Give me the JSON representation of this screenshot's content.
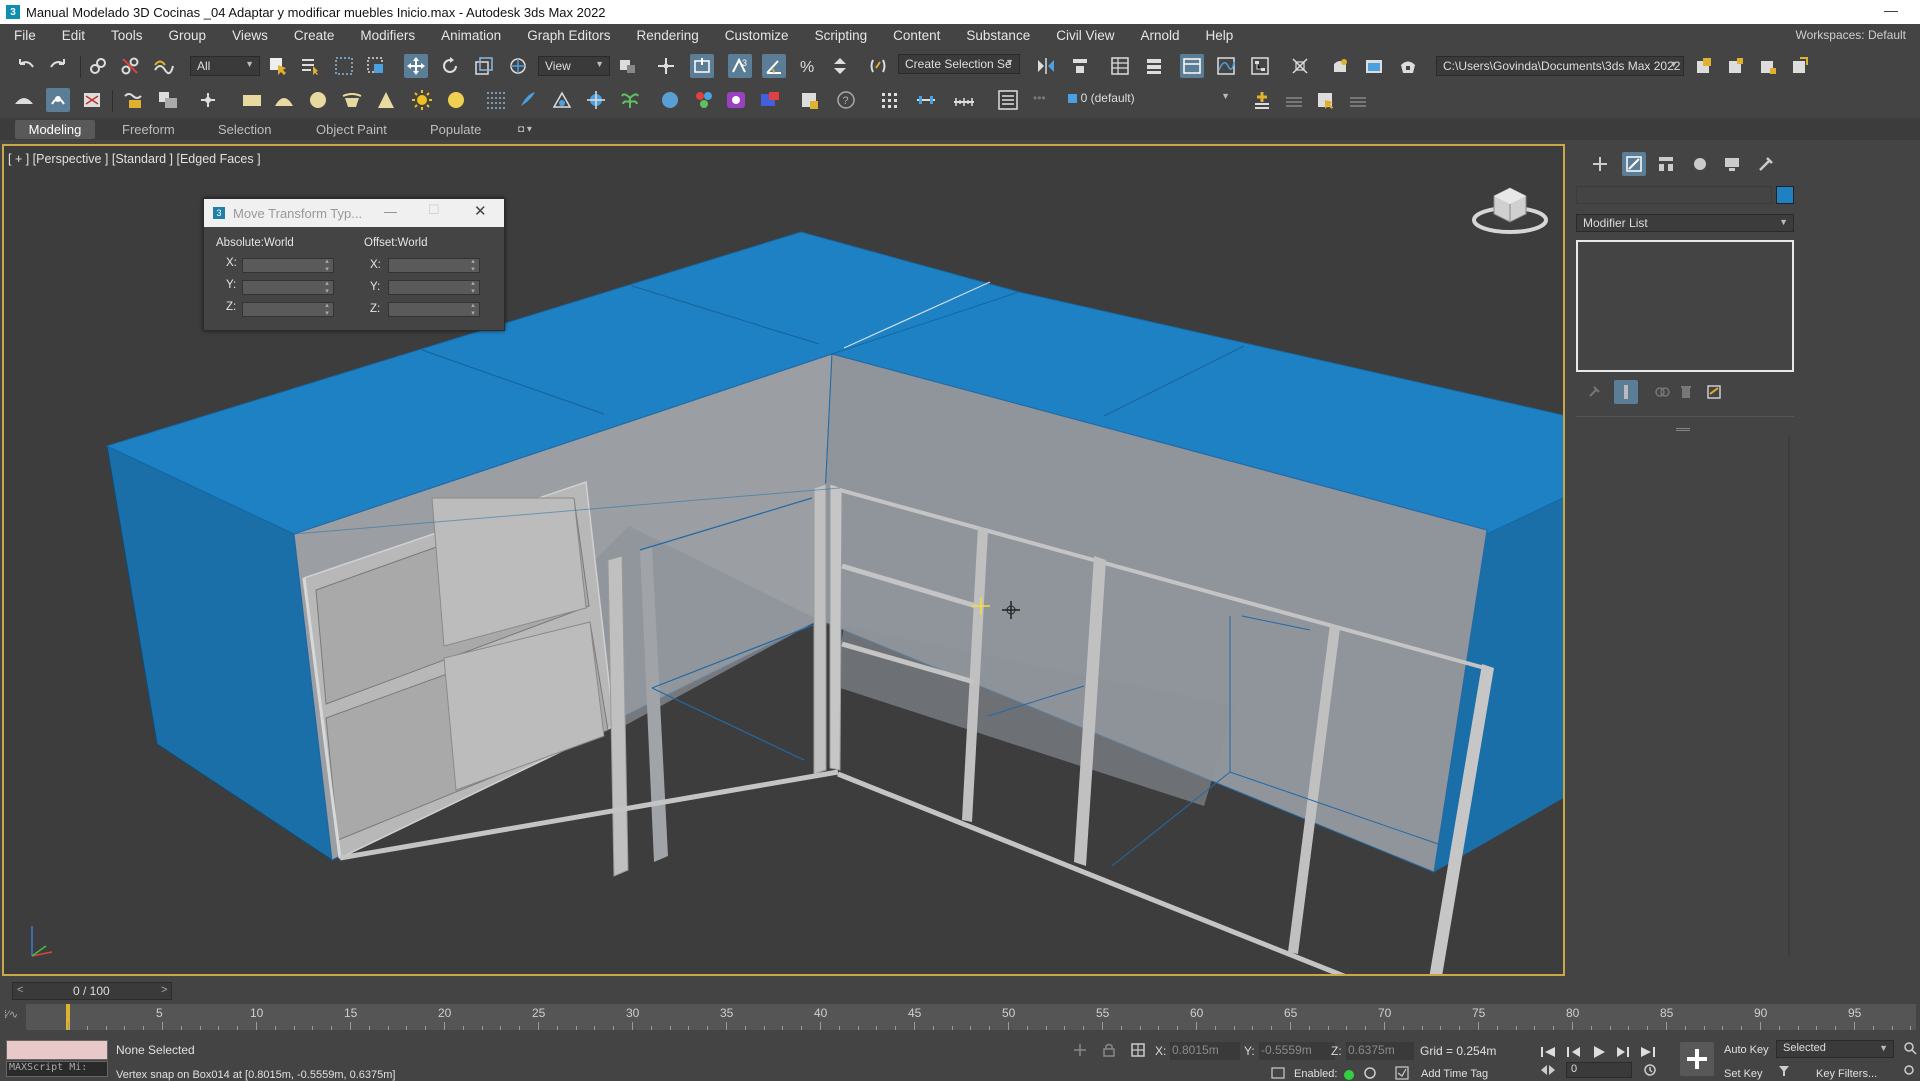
{
  "window": {
    "title": "Manual Modelado 3D Cocinas _04 Adaptar y modificar muebles Inicio.max - Autodesk 3ds Max 2022",
    "minimize": "—"
  },
  "menu": [
    "File",
    "Edit",
    "Tools",
    "Group",
    "Views",
    "Create",
    "Modifiers",
    "Animation",
    "Graph Editors",
    "Rendering",
    "Customize",
    "Scripting",
    "Content",
    "Substance",
    "Civil View",
    "Arnold",
    "Help"
  ],
  "workspaces": {
    "label": "Workspaces:",
    "value": "Default"
  },
  "toolbar": {
    "selection_filter": "All",
    "ref_coord": "View",
    "named_selection": "Create Selection Se",
    "project_path": "C:\\Users\\Govinda\\Documents\\3ds Max 2022",
    "layer": "0 (default)"
  },
  "ribbon": {
    "tabs": [
      "Modeling",
      "Freeform",
      "Selection",
      "Object Paint",
      "Populate"
    ],
    "selected": "Modeling"
  },
  "viewport": {
    "label": "[ + ] [Perspective ] [Standard ] [Edged Faces ]",
    "accent_color": "#1e81c4",
    "border_color": "#c9a84a"
  },
  "move_dialog": {
    "title": "Move Transform Typ...",
    "absolute_label": "Absolute:World",
    "offset_label": "Offset:World",
    "axes": [
      "X:",
      "Y:",
      "Z:"
    ]
  },
  "command_panel": {
    "tabs": [
      "create-icon",
      "modify-icon",
      "hierarchy-icon",
      "motion-icon",
      "display-icon",
      "utilities-icon"
    ],
    "modifier_list": "Modifier List",
    "object_color": "#1e81c4"
  },
  "timeline": {
    "slider": "0 / 100",
    "prev": "<",
    "next": ">",
    "ticks": [
      "0",
      "5",
      "10",
      "15",
      "20",
      "25",
      "30",
      "35",
      "40",
      "45",
      "50",
      "55",
      "60",
      "65",
      "70",
      "75",
      "80",
      "85",
      "90",
      "95"
    ]
  },
  "status": {
    "maxscript": "MAXScript Mi:",
    "selection": "None Selected",
    "prompt": "Vertex snap on Box014 at [0.8015m, -0.5559m, 0.6375m]",
    "x_label": "X:",
    "x_value": "0.8015m",
    "y_label": "Y:",
    "y_value": "-0.5559m",
    "z_label": "Z:",
    "z_value": "0.6375m",
    "grid": "Grid = 0.254m",
    "enabled": "Enabled:",
    "add_time_tag": "Add Time Tag",
    "auto_key": "Auto Key",
    "selected": "Selected",
    "set_key": "Set Key",
    "key_filters": "Key Filters...",
    "frame": "0"
  }
}
